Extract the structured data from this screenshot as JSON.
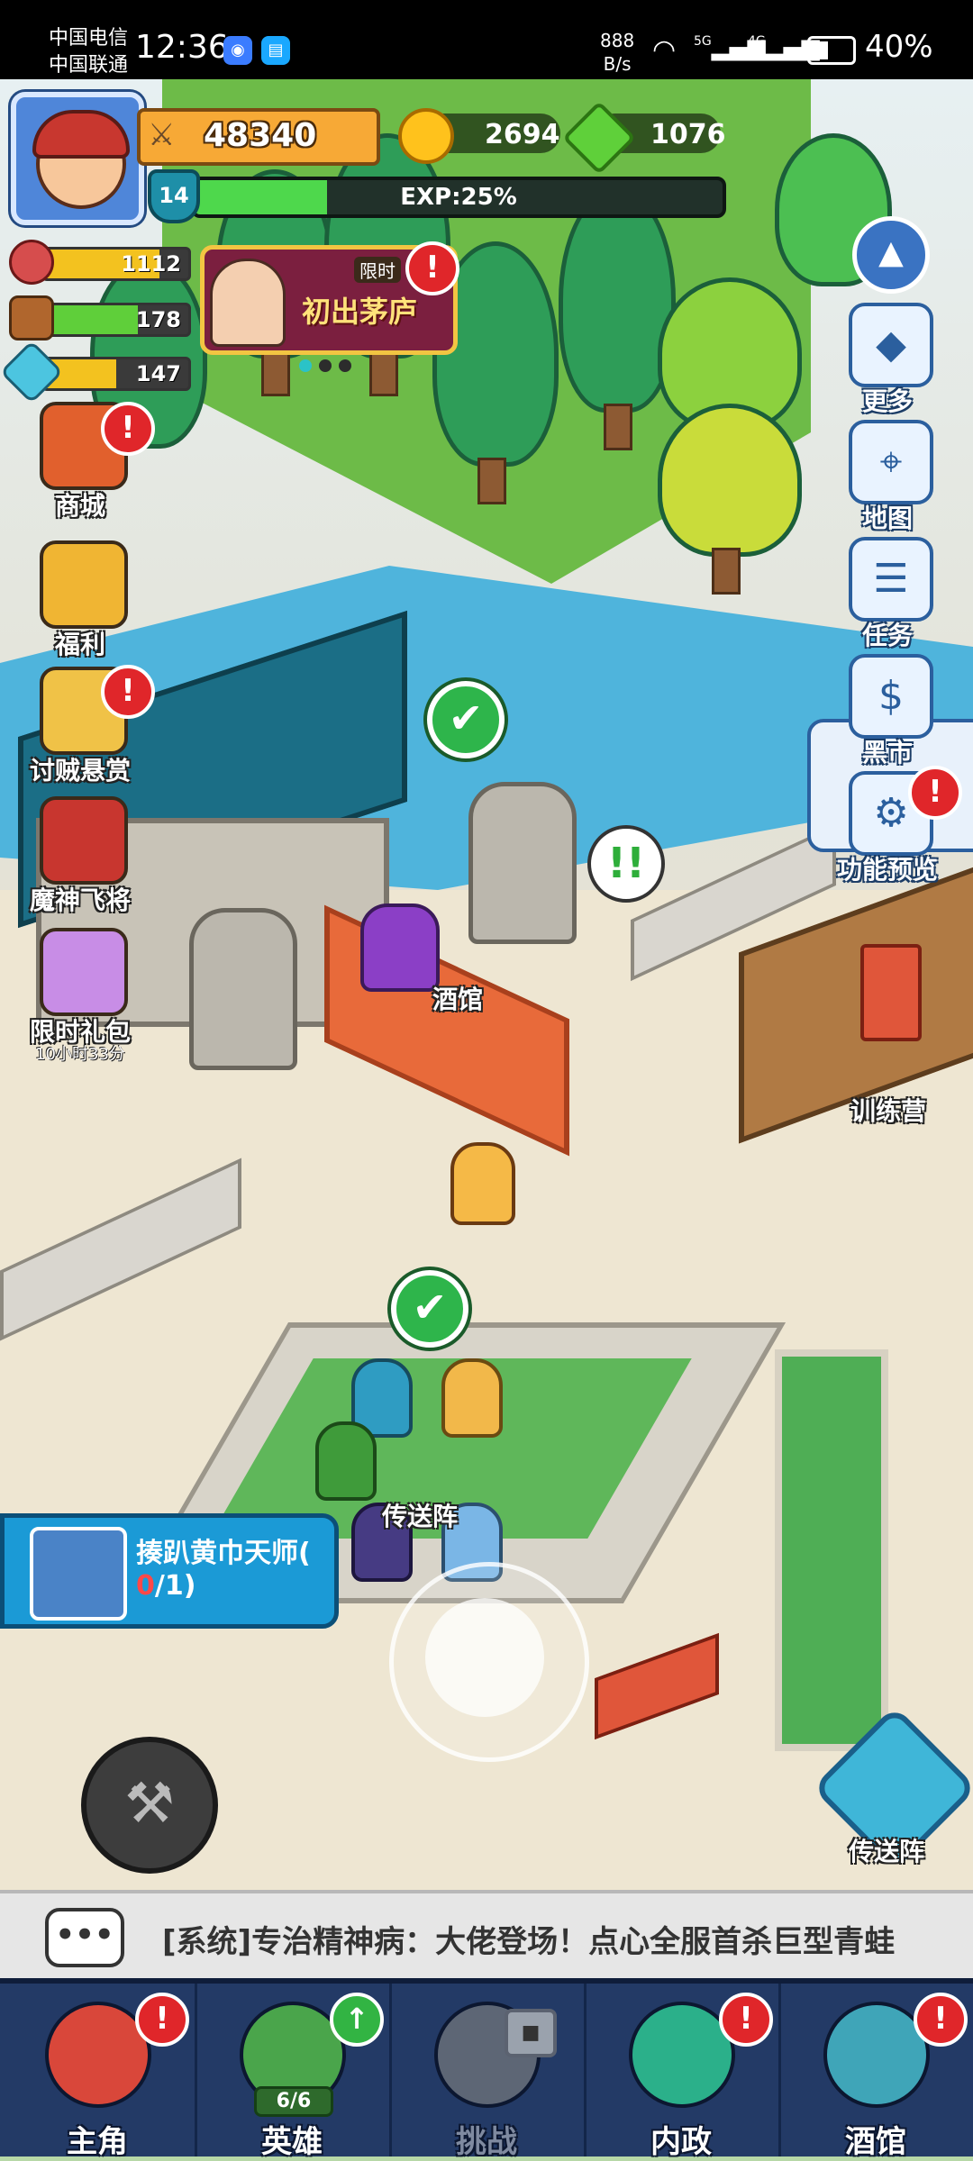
{
  "status_bar": {
    "carrier1": "中国电信",
    "carrier2": "中国联通",
    "time": "12:36",
    "speed_value": "888",
    "speed_unit": "B/s",
    "signal1": "5G",
    "signal2": "4G",
    "battery": "40%"
  },
  "hud": {
    "power": "48340",
    "gold": "2694",
    "gems": "1076",
    "level": "14",
    "exp_text": "EXP:25%",
    "exp_fraction": 0.25
  },
  "stats": {
    "food": {
      "value": "1112",
      "fraction": 0.8,
      "color": "#f3c21f"
    },
    "wood": {
      "value": "178",
      "fraction": 0.65,
      "color": "#5fcf3a"
    },
    "crystal": {
      "value": "147",
      "fraction": 0.5,
      "color": "#f3c21f"
    }
  },
  "event": {
    "tag": "限时",
    "title": "初出茅庐",
    "badge": "!"
  },
  "left_menu": [
    {
      "label": "商城",
      "sub": "",
      "badge": "!",
      "color": "#e1602d"
    },
    {
      "label": "福利",
      "sub": "",
      "badge": "",
      "color": "#f0b533"
    },
    {
      "label": "讨贼悬赏",
      "sub": "",
      "badge": "!",
      "color": "#f0c247"
    },
    {
      "label": "魔神飞将",
      "sub": "",
      "badge": "",
      "color": "#c8362f"
    },
    {
      "label": "限时礼包",
      "sub": "10小时33分",
      "badge": "",
      "color": "#c88de6"
    }
  ],
  "right_menu": [
    {
      "label": "更多",
      "icon": "◆"
    },
    {
      "label": "地图",
      "icon": "⌖"
    },
    {
      "label": "任务",
      "icon": "☰"
    },
    {
      "label": "黑市",
      "icon": "$"
    },
    {
      "label": "功能预览",
      "icon": "⚙",
      "badge": "!"
    }
  ],
  "collapse_icon": "▲",
  "map_labels": {
    "tavern": "酒馆",
    "camp": "训练营",
    "teleport": "传送阵"
  },
  "speech_icon": "!!",
  "check_icon": "✔",
  "quest": {
    "title": "揍趴黄巾天师(",
    "progress_current": "0",
    "progress_rest": "/1)"
  },
  "hammer_icon": "⚒",
  "teleport_button": {
    "label": "传送阵"
  },
  "chat": {
    "icon": "•••",
    "message": "[系统]专治精神病：大佬登场！点心全服首杀巨型青蛙"
  },
  "tabs": [
    {
      "label": "主角",
      "badge": "!",
      "color": "#d9473a"
    },
    {
      "label": "英雄",
      "badge": "↑",
      "count": "6/6",
      "color": "#4aa54b"
    },
    {
      "label": "挑战",
      "badge": "",
      "locked": true,
      "color": "#5d6675"
    },
    {
      "label": "内政",
      "badge": "!",
      "color": "#2bb08a"
    },
    {
      "label": "酒馆",
      "badge": "!",
      "color": "#3fa5b8"
    }
  ]
}
